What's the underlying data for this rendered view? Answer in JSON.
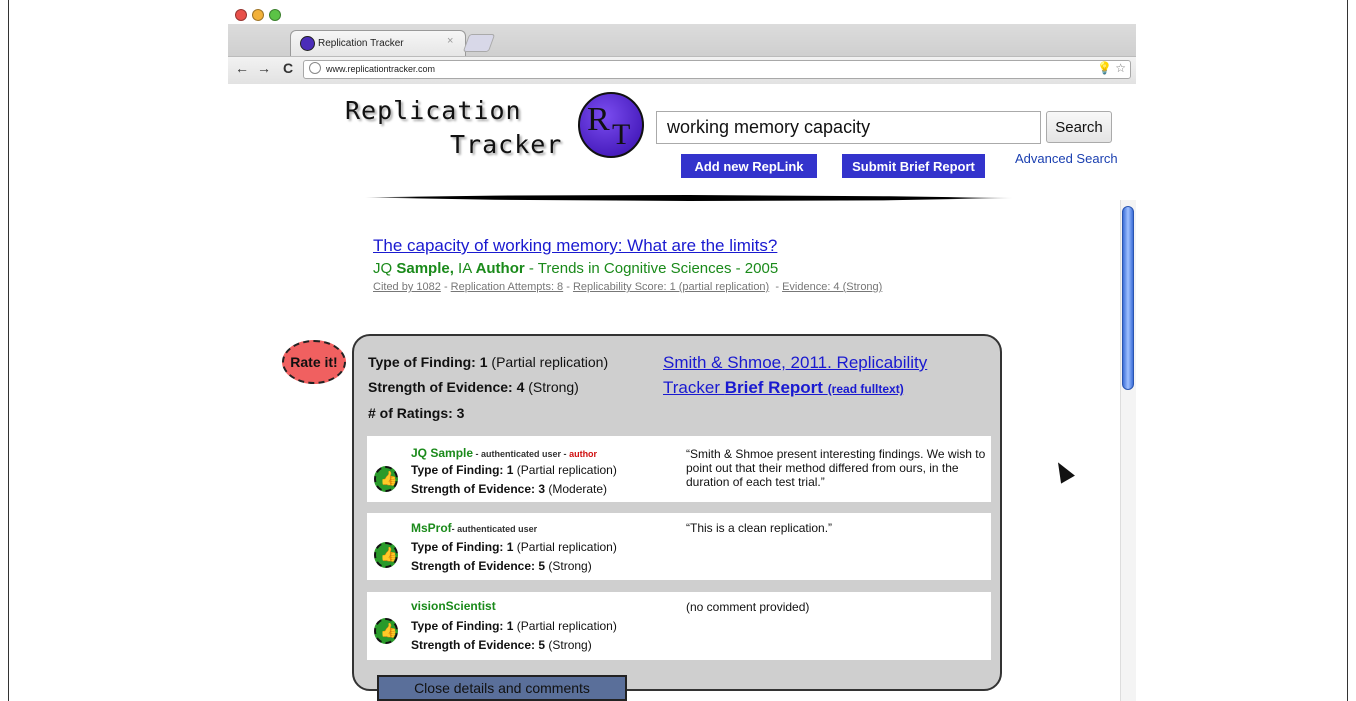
{
  "browser": {
    "tab_title": "Replication Tracker",
    "tab_close": "×",
    "url": "www.replicationtracker.com",
    "nav_back": "←",
    "nav_forward": "→",
    "nav_reload": "C",
    "url_tools": "💡 ☆"
  },
  "header": {
    "logo_line1": "Replication",
    "logo_line2": "Tracker",
    "logo_r": "R",
    "logo_t": "T"
  },
  "search": {
    "value": "working memory capacity",
    "button_label": "Search",
    "advanced_label": "Advanced Search",
    "add_replink_label": "Add new RepLink",
    "submit_brief_label": "Submit Brief Report"
  },
  "result": {
    "title": "The capacity of working memory: What are the limits?",
    "authors_prefix": "JQ ",
    "author1": "Sample,",
    "authors_mid": " IA ",
    "author2": "Author",
    "venue": " - Trends in Cognitive Sciences - 2005",
    "cited_by": "Cited by 1082",
    "sep": " - ",
    "replication_attempts": "Replication Attempts: 8",
    "replicability_score": "Replicability Score: 1 (partial replication)",
    "evidence": "Evidence: 4 (Strong)"
  },
  "rate_it_label": "Rate it!",
  "details": {
    "type_label": "Type of Finding:",
    "type_value": " 1",
    "type_note": " (Partial replication)",
    "strength_label": "Strength of Evidence:",
    "strength_value": " 4",
    "strength_note": " (Strong)",
    "ratings_label": "# of Ratings:",
    "ratings_value": " 3",
    "report_line1": "Smith & Shmoe, 2011. Replicability",
    "report_line2_prefix": "Tracker ",
    "report_line2_bold": "Brief Report",
    "read_fulltext": "(read fulltext)",
    "close_label": "Close details and comments"
  },
  "ratings": [
    {
      "user": "JQ Sample",
      "role": " - authenticated user - ",
      "author_tag": "author",
      "type_label": "Type of Finding:",
      "type_value": " 1",
      "type_note": " (Partial replication)",
      "strength_label": "Strength of Evidence:",
      "strength_value": " 3",
      "strength_note": " (Moderate)",
      "comment": "“Smith & Shmoe present interesting findings. We wish to point out that their method differed from ours, in the duration of each test trial.”"
    },
    {
      "user": "MsProf",
      "role": "- authenticated user",
      "author_tag": "",
      "type_label": "Type of Finding:",
      "type_value": " 1",
      "type_note": " (Partial replication)",
      "strength_label": "Strength of Evidence:",
      "strength_value": " 5",
      "strength_note": " (Strong)",
      "comment": "“This is a clean replication.”"
    },
    {
      "user": "visionScientist",
      "role": "",
      "author_tag": "",
      "type_label": "Type of Finding:",
      "type_value": " 1",
      "type_note": " (Partial replication)",
      "strength_label": "Strength of Evidence:",
      "strength_value": " 5",
      "strength_note": " (Strong)",
      "comment": "(no comment provided)"
    }
  ],
  "colors": {
    "accent_blue": "#3333cc",
    "link_blue": "#1a1ad0",
    "author_green": "#1a8a1a",
    "rate_red": "#f06060",
    "panel_gray": "#cfcfcf"
  },
  "icons": {
    "thumb": "thumbs-up-icon",
    "cursor": "mouse-cursor-icon"
  }
}
